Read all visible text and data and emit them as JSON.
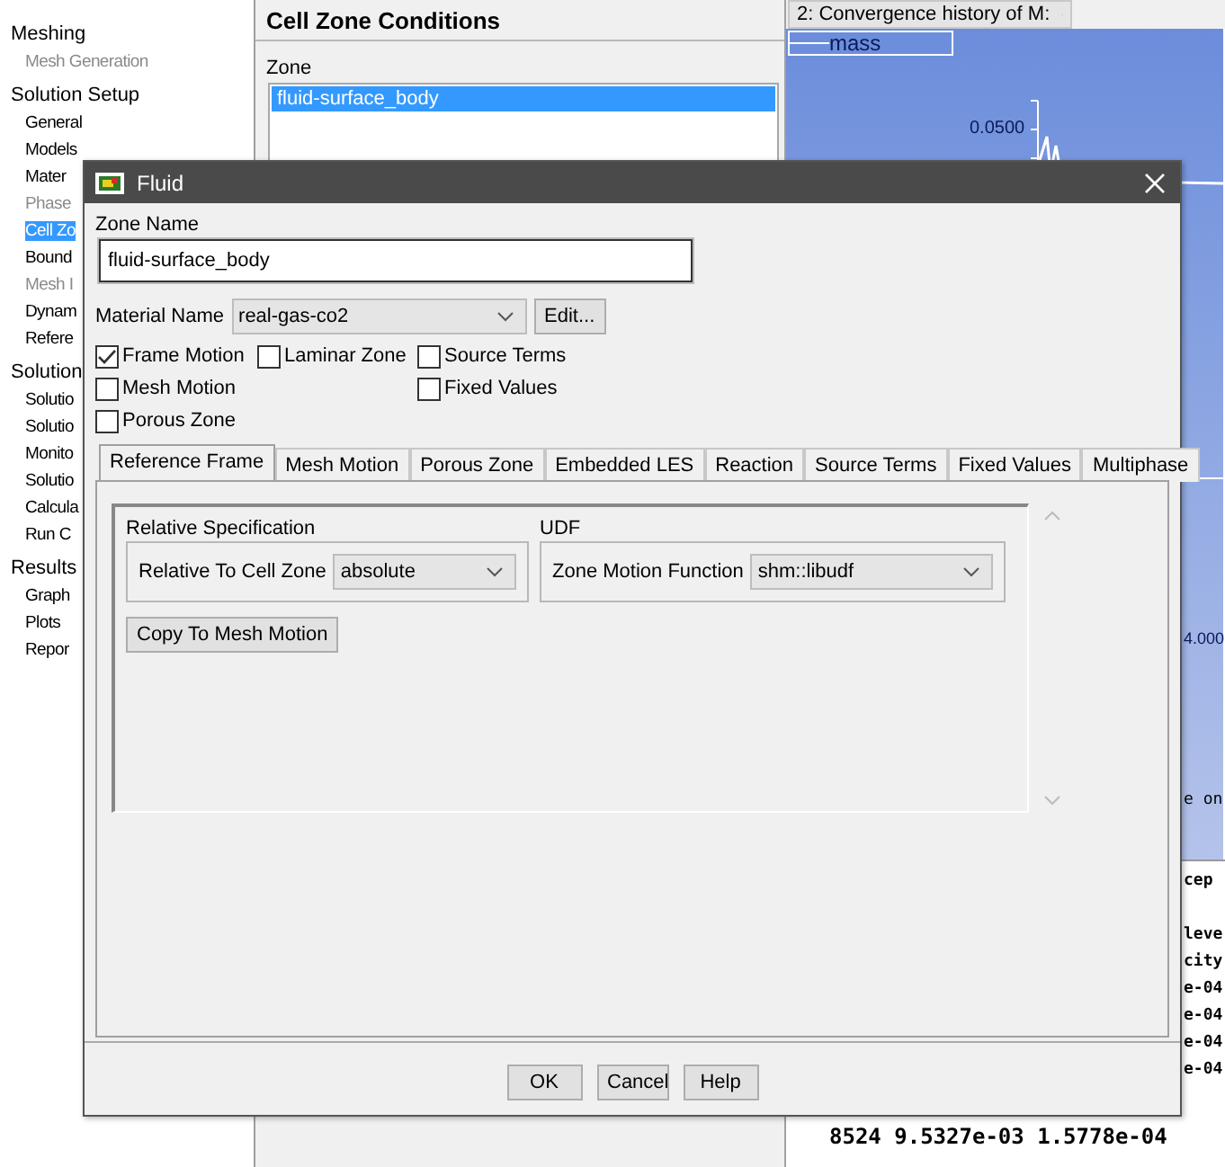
{
  "sidebar": {
    "items": [
      {
        "label": "Meshing",
        "kind": "heading",
        "disabled": false,
        "selected": false
      },
      {
        "label": "Mesh Generation",
        "kind": "item",
        "disabled": true,
        "selected": false
      },
      {
        "label": "Solution Setup",
        "kind": "heading",
        "disabled": false,
        "selected": false
      },
      {
        "label": "General",
        "kind": "item",
        "disabled": false,
        "selected": false
      },
      {
        "label": "Models",
        "kind": "item",
        "disabled": false,
        "selected": false
      },
      {
        "label": "Mater",
        "kind": "item",
        "disabled": false,
        "selected": false
      },
      {
        "label": "Phase",
        "kind": "item",
        "disabled": true,
        "selected": false
      },
      {
        "label": "Cell Zo",
        "kind": "item",
        "disabled": false,
        "selected": true
      },
      {
        "label": "Bound",
        "kind": "item",
        "disabled": false,
        "selected": false
      },
      {
        "label": "Mesh I",
        "kind": "item",
        "disabled": true,
        "selected": false
      },
      {
        "label": "Dynam",
        "kind": "item",
        "disabled": false,
        "selected": false
      },
      {
        "label": "Refere",
        "kind": "item",
        "disabled": false,
        "selected": false
      },
      {
        "label": "Solution",
        "kind": "heading",
        "disabled": false,
        "selected": false
      },
      {
        "label": "Solutio",
        "kind": "item",
        "disabled": false,
        "selected": false
      },
      {
        "label": "Solutio",
        "kind": "item",
        "disabled": false,
        "selected": false
      },
      {
        "label": "Monito",
        "kind": "item",
        "disabled": false,
        "selected": false
      },
      {
        "label": "Solutio",
        "kind": "item",
        "disabled": false,
        "selected": false
      },
      {
        "label": "Calcula",
        "kind": "item",
        "disabled": false,
        "selected": false
      },
      {
        "label": "Run C",
        "kind": "item",
        "disabled": false,
        "selected": false
      },
      {
        "label": "Results",
        "kind": "heading",
        "disabled": false,
        "selected": false
      },
      {
        "label": "Graph",
        "kind": "item",
        "disabled": false,
        "selected": false
      },
      {
        "label": "Plots",
        "kind": "item",
        "disabled": false,
        "selected": false
      },
      {
        "label": "Repor",
        "kind": "item",
        "disabled": false,
        "selected": false
      }
    ]
  },
  "panel": {
    "title": "Cell Zone Conditions",
    "zone_label": "Zone",
    "zones": [
      {
        "label": "fluid-surface_body",
        "selected": true
      }
    ]
  },
  "graph": {
    "dropdown": "2: Convergence history of M:",
    "legend": "mass",
    "y_tick": "0.0500",
    "x_tick": "4.000",
    "caption": "e on"
  },
  "console": {
    "header": "cep",
    "lines": [
      "leve",
      "city",
      "e-04",
      "e-04",
      "e-04",
      "e-04"
    ],
    "last_line": "8524  9.5327e-03  1.5778e-04"
  },
  "dialog": {
    "title": "Fluid",
    "zone_name_label": "Zone Name",
    "zone_name": "fluid-surface_body",
    "material_label": "Material Name",
    "material": "real-gas-co2",
    "edit_button": "Edit...",
    "checkboxes": [
      {
        "label": "Frame Motion",
        "checked": true
      },
      {
        "label": "Laminar Zone",
        "checked": false
      },
      {
        "label": "Source Terms",
        "checked": false
      },
      {
        "label": "Mesh Motion",
        "checked": false
      },
      {
        "label": "Fixed Values",
        "checked": false
      },
      {
        "label": "Porous Zone",
        "checked": false
      }
    ],
    "tabs": [
      {
        "label": "Reference Frame",
        "selected": true
      },
      {
        "label": "Mesh Motion",
        "selected": false
      },
      {
        "label": "Porous Zone",
        "selected": false
      },
      {
        "label": "Embedded LES",
        "selected": false
      },
      {
        "label": "Reaction",
        "selected": false
      },
      {
        "label": "Source Terms",
        "selected": false
      },
      {
        "label": "Fixed Values",
        "selected": false
      },
      {
        "label": "Multiphase",
        "selected": false
      }
    ],
    "relative": {
      "title": "Relative Specification",
      "label": "Relative To Cell Zone",
      "value": "absolute"
    },
    "udf": {
      "title": "UDF",
      "label": "Zone Motion Function",
      "value": "shm::libudf"
    },
    "copy_button": "Copy To Mesh Motion",
    "buttons": [
      "OK",
      "Cancel",
      "Help"
    ]
  }
}
